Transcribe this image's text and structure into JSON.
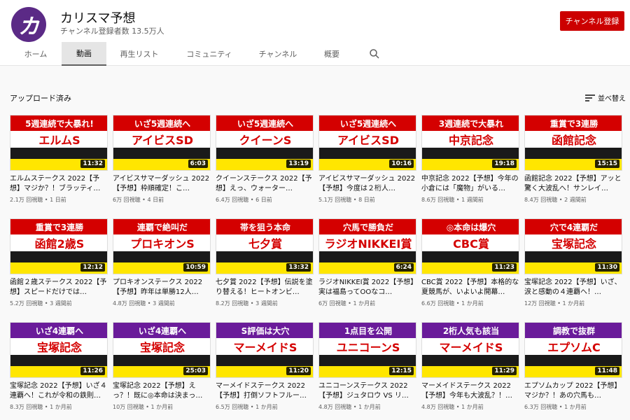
{
  "channel": {
    "avatar_glyph": "カ",
    "name": "カリスマ予想",
    "subscribers": "チャンネル登録者数 13.5万人",
    "subscribe_label": "チャンネル登録"
  },
  "tabs": [
    {
      "label": "ホーム",
      "active": false
    },
    {
      "label": "動画",
      "active": true
    },
    {
      "label": "再生リスト",
      "active": false
    },
    {
      "label": "コミュニティ",
      "active": false
    },
    {
      "label": "チャンネル",
      "active": false
    },
    {
      "label": "概要",
      "active": false
    }
  ],
  "section_title": "アップロード済み",
  "sort_label": "並べ替え",
  "videos": [
    {
      "banner": "5週連続で大暴れ!",
      "thumb_title": "エルムS",
      "banner_color": "#d40000",
      "duration": "11:32",
      "title": "エルムステークス 2022【予想】マジか？！ブラッティ…",
      "views": "2.1万 回視聴",
      "age": "1 日前"
    },
    {
      "banner": "いざ5週連続へ",
      "thumb_title": "アイビスSD",
      "banner_color": "#d40000",
      "duration": "6:03",
      "title": "アイビスサマーダッシュ 2022【予想】枠順確定！こ…",
      "views": "6万 回視聴",
      "age": "4 日前"
    },
    {
      "banner": "いざ5週連続へ",
      "thumb_title": "クイーンS",
      "banner_color": "#d40000",
      "duration": "13:19",
      "title": "クイーンステークス 2022【予想】えっ、ウォーター…",
      "views": "6.4万 回視聴",
      "age": "6 日前"
    },
    {
      "banner": "いざ5週連続へ",
      "thumb_title": "アイビスSD",
      "banner_color": "#d40000",
      "duration": "10:16",
      "title": "アイビスサマーダッシュ 2022【予想】今度は２桁人…",
      "views": "5.1万 回視聴",
      "age": "8 日前"
    },
    {
      "banner": "3週連続で大暴れ",
      "thumb_title": "中京記念",
      "banner_color": "#d40000",
      "duration": "19:18",
      "title": "中京記念 2022【予想】今年の小倉には「魔物」がいる…",
      "views": "8.6万 回視聴",
      "age": "1 週間前"
    },
    {
      "banner": "重賞で3連勝",
      "thumb_title": "函館記念",
      "banner_color": "#d40000",
      "duration": "15:15",
      "title": "函館記念 2022【予想】アッと驚く大波乱へ！サンレイ…",
      "views": "8.4万 回視聴",
      "age": "2 週間前"
    },
    {
      "banner": "重賞で3連勝",
      "thumb_title": "函館2歳S",
      "banner_color": "#d40000",
      "duration": "12:12",
      "title": "函館２歳ステークス 2022【予想】スピードだけでは…",
      "views": "5.2万 回視聴",
      "age": "3 週間前"
    },
    {
      "banner": "連覇で絶叫だ",
      "thumb_title": "プロキオンS",
      "banner_color": "#d40000",
      "duration": "10:59",
      "title": "プロキオンステークス 2022【予想】昨年は単勝12人…",
      "views": "4.8万 回視聴",
      "age": "3 週間前"
    },
    {
      "banner": "帯を狙う本命",
      "thumb_title": "七夕賞",
      "banner_color": "#d40000",
      "duration": "13:32",
      "title": "七夕賞 2022【予想】伝説を塗り替える！ヒートオンビ…",
      "views": "8.2万 回視聴",
      "age": "3 週間前"
    },
    {
      "banner": "穴馬で勝負だ",
      "thumb_title": "ラジオNIKKEI賞",
      "banner_color": "#d40000",
      "duration": "6:24",
      "title": "ラジオNIKKEI賞 2022【予想】実は福島ってOOなコ…",
      "views": "6万 回視聴",
      "age": "1 か月前"
    },
    {
      "banner": "◎本命は爆穴",
      "thumb_title": "CBC賞",
      "banner_color": "#d40000",
      "duration": "11:23",
      "title": "CBC賞 2022【予想】本格的な夏競馬が、いよいよ開幕…",
      "views": "6.6万 回視聴",
      "age": "1 か月前"
    },
    {
      "banner": "穴で4連覇だ",
      "thumb_title": "宝塚記念",
      "banner_color": "#d40000",
      "duration": "11:30",
      "title": "宝塚記念 2022【予想】いざ、涙と感動の４連覇へ！…",
      "views": "12万 回視聴",
      "age": "1 か月前"
    },
    {
      "banner": "いざ4連覇へ",
      "thumb_title": "宝塚記念",
      "banner_color": "#6a1b9a",
      "duration": "11:26",
      "title": "宝塚記念 2022【予想】いざ４連覇へ！これが令和の鉄則…",
      "views": "8.3万 回視聴",
      "age": "1 か月前"
    },
    {
      "banner": "いざ4連覇へ",
      "thumb_title": "宝塚記念",
      "banner_color": "#6a1b9a",
      "duration": "25:03",
      "title": "宝塚記念 2022【予想】えっ？！既に◎本命は決まっ…",
      "views": "10万 回視聴",
      "age": "1 か月前"
    },
    {
      "banner": "S評価は大穴",
      "thumb_title": "マーメイドS",
      "banner_color": "#6a1b9a",
      "duration": "11:20",
      "title": "マーメイドステークス 2022【予想】打倒ソフトフルー…",
      "views": "6.5万 回視聴",
      "age": "1 か月前"
    },
    {
      "banner": "1点目を公開",
      "thumb_title": "ユニコーンS",
      "banner_color": "#6a1b9a",
      "duration": "12:15",
      "title": "ユニコーンステークス 2022【予想】ジュタロウ VS リ…",
      "views": "4.8万 回視聴",
      "age": "1 か月前"
    },
    {
      "banner": "2桁人気も該当",
      "thumb_title": "マーメイドS",
      "banner_color": "#6a1b9a",
      "duration": "11:29",
      "title": "マーメイドステークス 2022【予想】今年も大波乱？！…",
      "views": "4.8万 回視聴",
      "age": "1 か月前"
    },
    {
      "banner": "調教で抜群",
      "thumb_title": "エプソムC",
      "banner_color": "#6a1b9a",
      "duration": "11:48",
      "title": "エプソムカップ 2022【予想】マジか？！あの穴馬も…",
      "views": "6.3万 回視聴",
      "age": "1 か月前"
    }
  ]
}
